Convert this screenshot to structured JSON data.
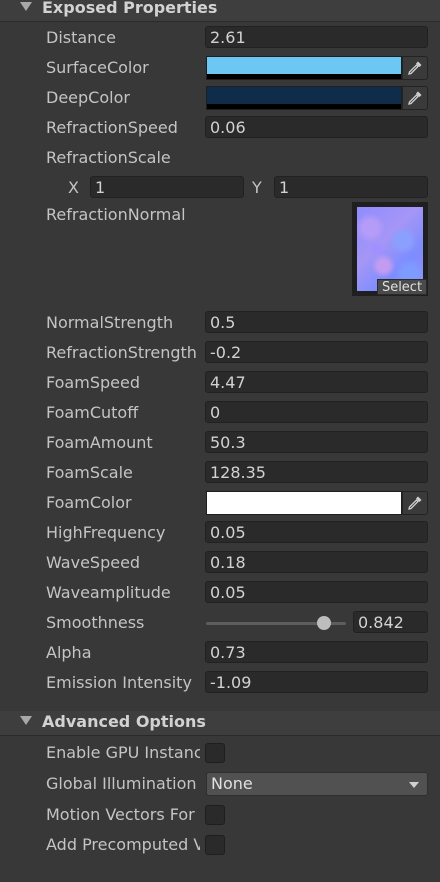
{
  "exposed": {
    "title": "Exposed Properties",
    "distance": {
      "label": "Distance",
      "value": "2.61"
    },
    "surface_color": {
      "label": "SurfaceColor",
      "color": "#6cc8f3"
    },
    "deep_color": {
      "label": "DeepColor",
      "color": "#0f2d4a"
    },
    "refraction_speed": {
      "label": "RefractionSpeed",
      "value": "0.06"
    },
    "refraction_scale": {
      "label": "RefractionScale",
      "x_label": "X",
      "x_value": "1",
      "y_label": "Y",
      "y_value": "1"
    },
    "refraction_normal": {
      "label": "RefractionNormal",
      "select_label": "Select"
    },
    "normal_strength": {
      "label": "NormalStrength",
      "value": "0.5"
    },
    "refraction_strength": {
      "label": "RefractionStrength",
      "value": "-0.2"
    },
    "foam_speed": {
      "label": "FoamSpeed",
      "value": "4.47"
    },
    "foam_cutoff": {
      "label": "FoamCutoff",
      "value": "0"
    },
    "foam_amount": {
      "label": "FoamAmount",
      "value": "50.3"
    },
    "foam_scale": {
      "label": "FoamScale",
      "value": "128.35"
    },
    "foam_color": {
      "label": "FoamColor",
      "color": "#ffffff"
    },
    "high_frequency": {
      "label": "HighFrequency",
      "value": "0.05"
    },
    "wave_speed": {
      "label": "WaveSpeed",
      "value": "0.18"
    },
    "wave_amplitude": {
      "label": "Waveamplitude",
      "value": "0.05"
    },
    "smoothness": {
      "label": "Smoothness",
      "value": "0.842",
      "level": 0.842
    },
    "alpha": {
      "label": "Alpha",
      "value": "0.73"
    },
    "emission_intensity": {
      "label": "Emission Intensity",
      "value": "-1.09"
    }
  },
  "advanced": {
    "title": "Advanced Options",
    "gpu_instancing": {
      "label": "Enable GPU Instancing",
      "checked": false
    },
    "global_illumination": {
      "label": "Global Illumination",
      "value": "None"
    },
    "motion_vectors": {
      "label": "Motion Vectors For Vertex Animation",
      "checked": false
    },
    "add_precomputed": {
      "label": "Add Precomputed Velocity",
      "checked": false
    }
  },
  "icons": {
    "picker": "eyedropper-icon",
    "foldout": "foldout-arrow-icon",
    "dropdown": "chevron-down-icon"
  }
}
